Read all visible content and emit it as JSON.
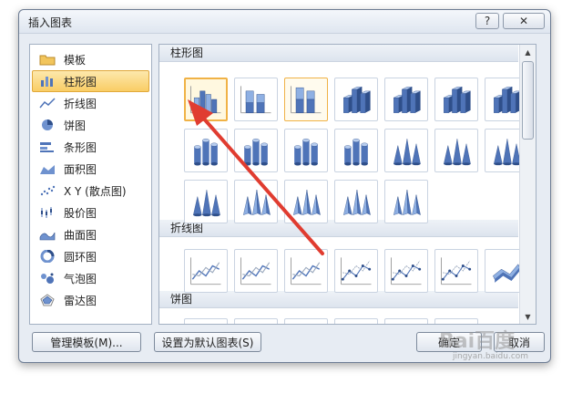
{
  "window": {
    "title": "插入图表",
    "help": "?",
    "close": "✕"
  },
  "categories": [
    {
      "label": "模板",
      "icon": "folder-icon",
      "selected": false
    },
    {
      "label": "柱形图",
      "icon": "column-chart-icon",
      "selected": true
    },
    {
      "label": "折线图",
      "icon": "line-chart-icon",
      "selected": false
    },
    {
      "label": "饼图",
      "icon": "pie-chart-icon",
      "selected": false
    },
    {
      "label": "条形图",
      "icon": "bar-chart-icon",
      "selected": false
    },
    {
      "label": "面积图",
      "icon": "area-chart-icon",
      "selected": false
    },
    {
      "label": "X Y (散点图)",
      "icon": "scatter-chart-icon",
      "selected": false
    },
    {
      "label": "股价图",
      "icon": "stock-chart-icon",
      "selected": false
    },
    {
      "label": "曲面图",
      "icon": "surface-chart-icon",
      "selected": false
    },
    {
      "label": "圆环图",
      "icon": "doughnut-chart-icon",
      "selected": false
    },
    {
      "label": "气泡图",
      "icon": "bubble-chart-icon",
      "selected": false
    },
    {
      "label": "雷达图",
      "icon": "radar-chart-icon",
      "selected": false
    }
  ],
  "sections": [
    {
      "title": "柱形图"
    },
    {
      "title": "折线图"
    },
    {
      "title": "饼图"
    }
  ],
  "buttons": {
    "manage": "管理模板(M)...",
    "set_default": "设置为默认图表(S)",
    "ok": "确定",
    "cancel": "取消"
  },
  "watermark": {
    "brand": "Bai百度",
    "url": "jingyan.baidu.com"
  },
  "colors": {
    "accent": "#f0b246",
    "chart_blue": "#4f74b8",
    "arrow": "#e03c30"
  }
}
